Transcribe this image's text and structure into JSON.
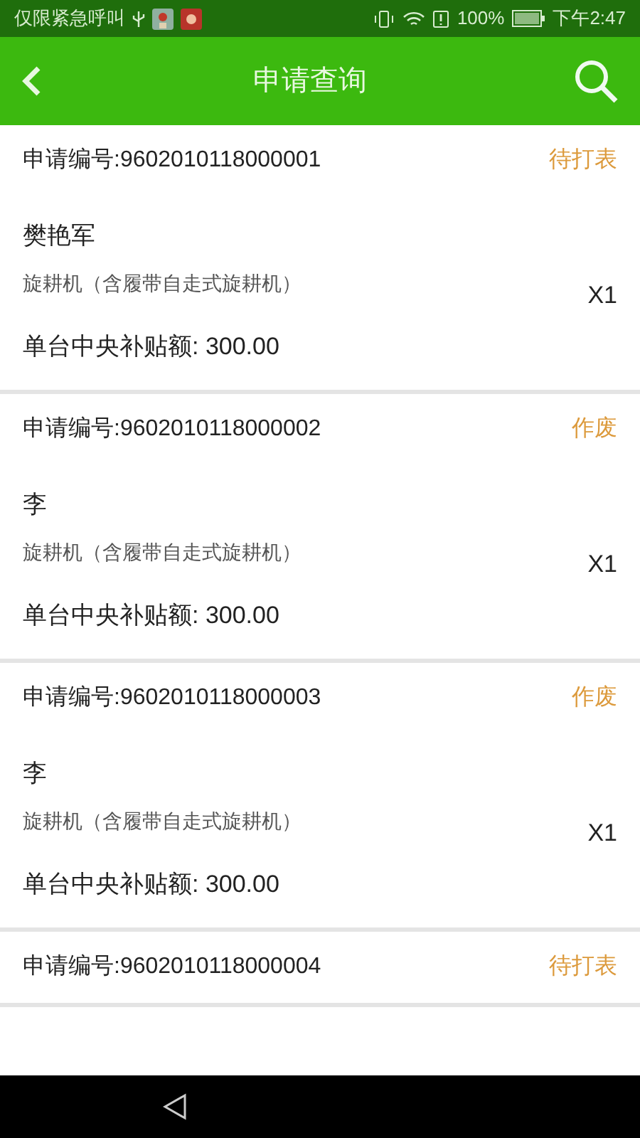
{
  "status_bar": {
    "carrier": "仅限紧急呼叫",
    "battery": "100%",
    "time": "下午2:47"
  },
  "header": {
    "title": "申请查询"
  },
  "applications": [
    {
      "number": "申请编号:9602010118000001",
      "status": "待打表",
      "applicant": "樊艳军",
      "product": "旋耕机（含履带自走式旋耕机）",
      "quantity": "X1",
      "subsidy": "单台中央补贴额: 300.00"
    },
    {
      "number": "申请编号:9602010118000002",
      "status": "作废",
      "applicant": "李",
      "product": "旋耕机（含履带自走式旋耕机）",
      "quantity": "X1",
      "subsidy": "单台中央补贴额: 300.00"
    },
    {
      "number": "申请编号:9602010118000003",
      "status": "作废",
      "applicant": "李",
      "product": "旋耕机（含履带自走式旋耕机）",
      "quantity": "X1",
      "subsidy": "单台中央补贴额: 300.00"
    },
    {
      "number": "申请编号:9602010118000004",
      "status": "待打表"
    }
  ]
}
